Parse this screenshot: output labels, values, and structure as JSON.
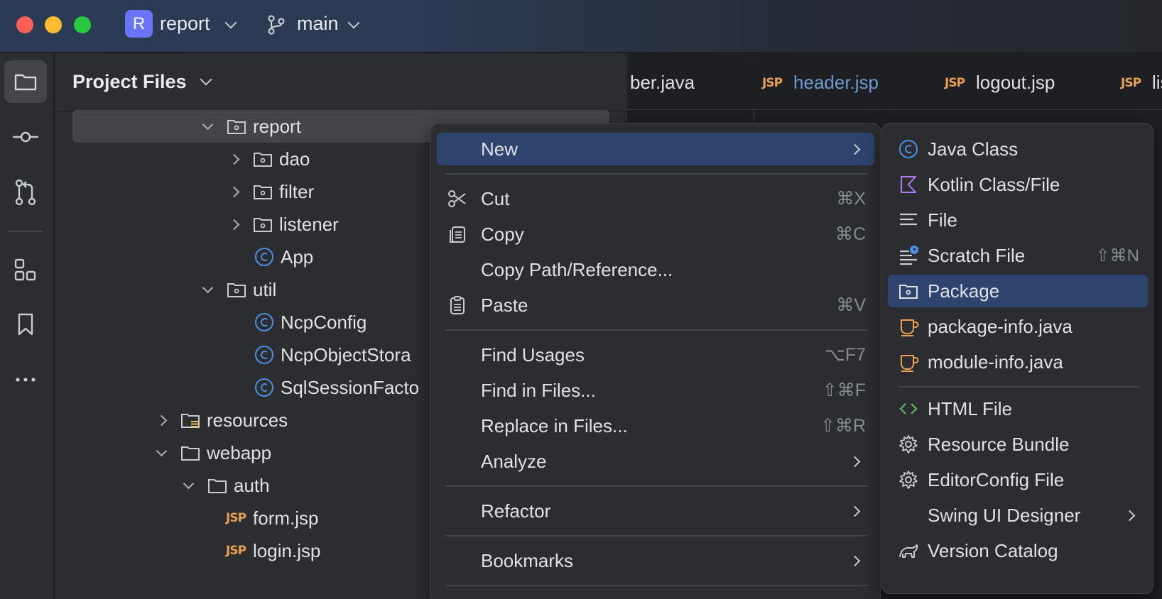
{
  "titlebar": {
    "project_initial": "R",
    "project_name": "report",
    "branch_name": "main"
  },
  "toolstrip": {
    "items": [
      "folder-icon",
      "commit-icon",
      "pull-request-icon",
      "structure-icon",
      "bookmark-icon",
      "more-icon"
    ]
  },
  "project_panel": {
    "title": "Project Files",
    "tree": [
      {
        "label": "report",
        "kind": "package",
        "expanded": true,
        "selected": true
      },
      {
        "label": "dao",
        "kind": "package",
        "expanded": false
      },
      {
        "label": "filter",
        "kind": "package",
        "expanded": false
      },
      {
        "label": "listener",
        "kind": "package",
        "expanded": false
      },
      {
        "label": "App",
        "kind": "class"
      },
      {
        "label": "util",
        "kind": "package",
        "expanded": true
      },
      {
        "label": "NcpConfig",
        "kind": "class"
      },
      {
        "label": "NcpObjectStora",
        "kind": "class"
      },
      {
        "label": "SqlSessionFacto",
        "kind": "class"
      },
      {
        "label": "resources",
        "kind": "resources-folder",
        "expanded": false
      },
      {
        "label": "webapp",
        "kind": "folder",
        "expanded": true
      },
      {
        "label": "auth",
        "kind": "folder",
        "expanded": true
      },
      {
        "label": "form.jsp",
        "kind": "jsp"
      },
      {
        "label": "login.jsp",
        "kind": "jsp"
      }
    ]
  },
  "editor": {
    "tabs": [
      {
        "label": "ber.java",
        "icon": ""
      },
      {
        "label": "header.jsp",
        "icon": "JSP"
      },
      {
        "label": "logout.jsp",
        "icon": "JSP"
      },
      {
        "label": "lis",
        "icon": "JSP"
      }
    ]
  },
  "context_menu": {
    "items": [
      {
        "label": "New",
        "shortcut": "",
        "submenu": true
      },
      {
        "label": "Cut",
        "shortcut": "⌘X"
      },
      {
        "label": "Copy",
        "shortcut": "⌘C"
      },
      {
        "label": "Copy Path/Reference...",
        "shortcut": ""
      },
      {
        "label": "Paste",
        "shortcut": "⌘V"
      },
      {
        "label": "Find Usages",
        "shortcut": "⌥F7"
      },
      {
        "label": "Find in Files...",
        "shortcut": "⇧⌘F"
      },
      {
        "label": "Replace in Files...",
        "shortcut": "⇧⌘R"
      },
      {
        "label": "Analyze",
        "shortcut": "",
        "submenu": true
      },
      {
        "label": "Refactor",
        "shortcut": "",
        "submenu": true
      },
      {
        "label": "Bookmarks",
        "shortcut": "",
        "submenu": true
      }
    ]
  },
  "new_submenu": {
    "items": [
      {
        "label": "Java Class",
        "shortcut": ""
      },
      {
        "label": "Kotlin Class/File",
        "shortcut": ""
      },
      {
        "label": "File",
        "shortcut": ""
      },
      {
        "label": "Scratch File",
        "shortcut": "⇧⌘N"
      },
      {
        "label": "Package",
        "shortcut": "",
        "selected": true
      },
      {
        "label": "package-info.java",
        "shortcut": ""
      },
      {
        "label": "module-info.java",
        "shortcut": ""
      },
      {
        "label": "HTML File",
        "shortcut": ""
      },
      {
        "label": "Resource Bundle",
        "shortcut": ""
      },
      {
        "label": "EditorConfig File",
        "shortcut": ""
      },
      {
        "label": "Swing UI Designer",
        "shortcut": "",
        "submenu": true
      },
      {
        "label": "Version Catalog",
        "shortcut": ""
      }
    ]
  },
  "colors": {
    "accent": "#2e436e",
    "class_icon": "#4d8fe5",
    "jsp_icon": "#e8a154",
    "html_icon": "#5fb85f",
    "kotlin_icon": "#b07cf0"
  }
}
